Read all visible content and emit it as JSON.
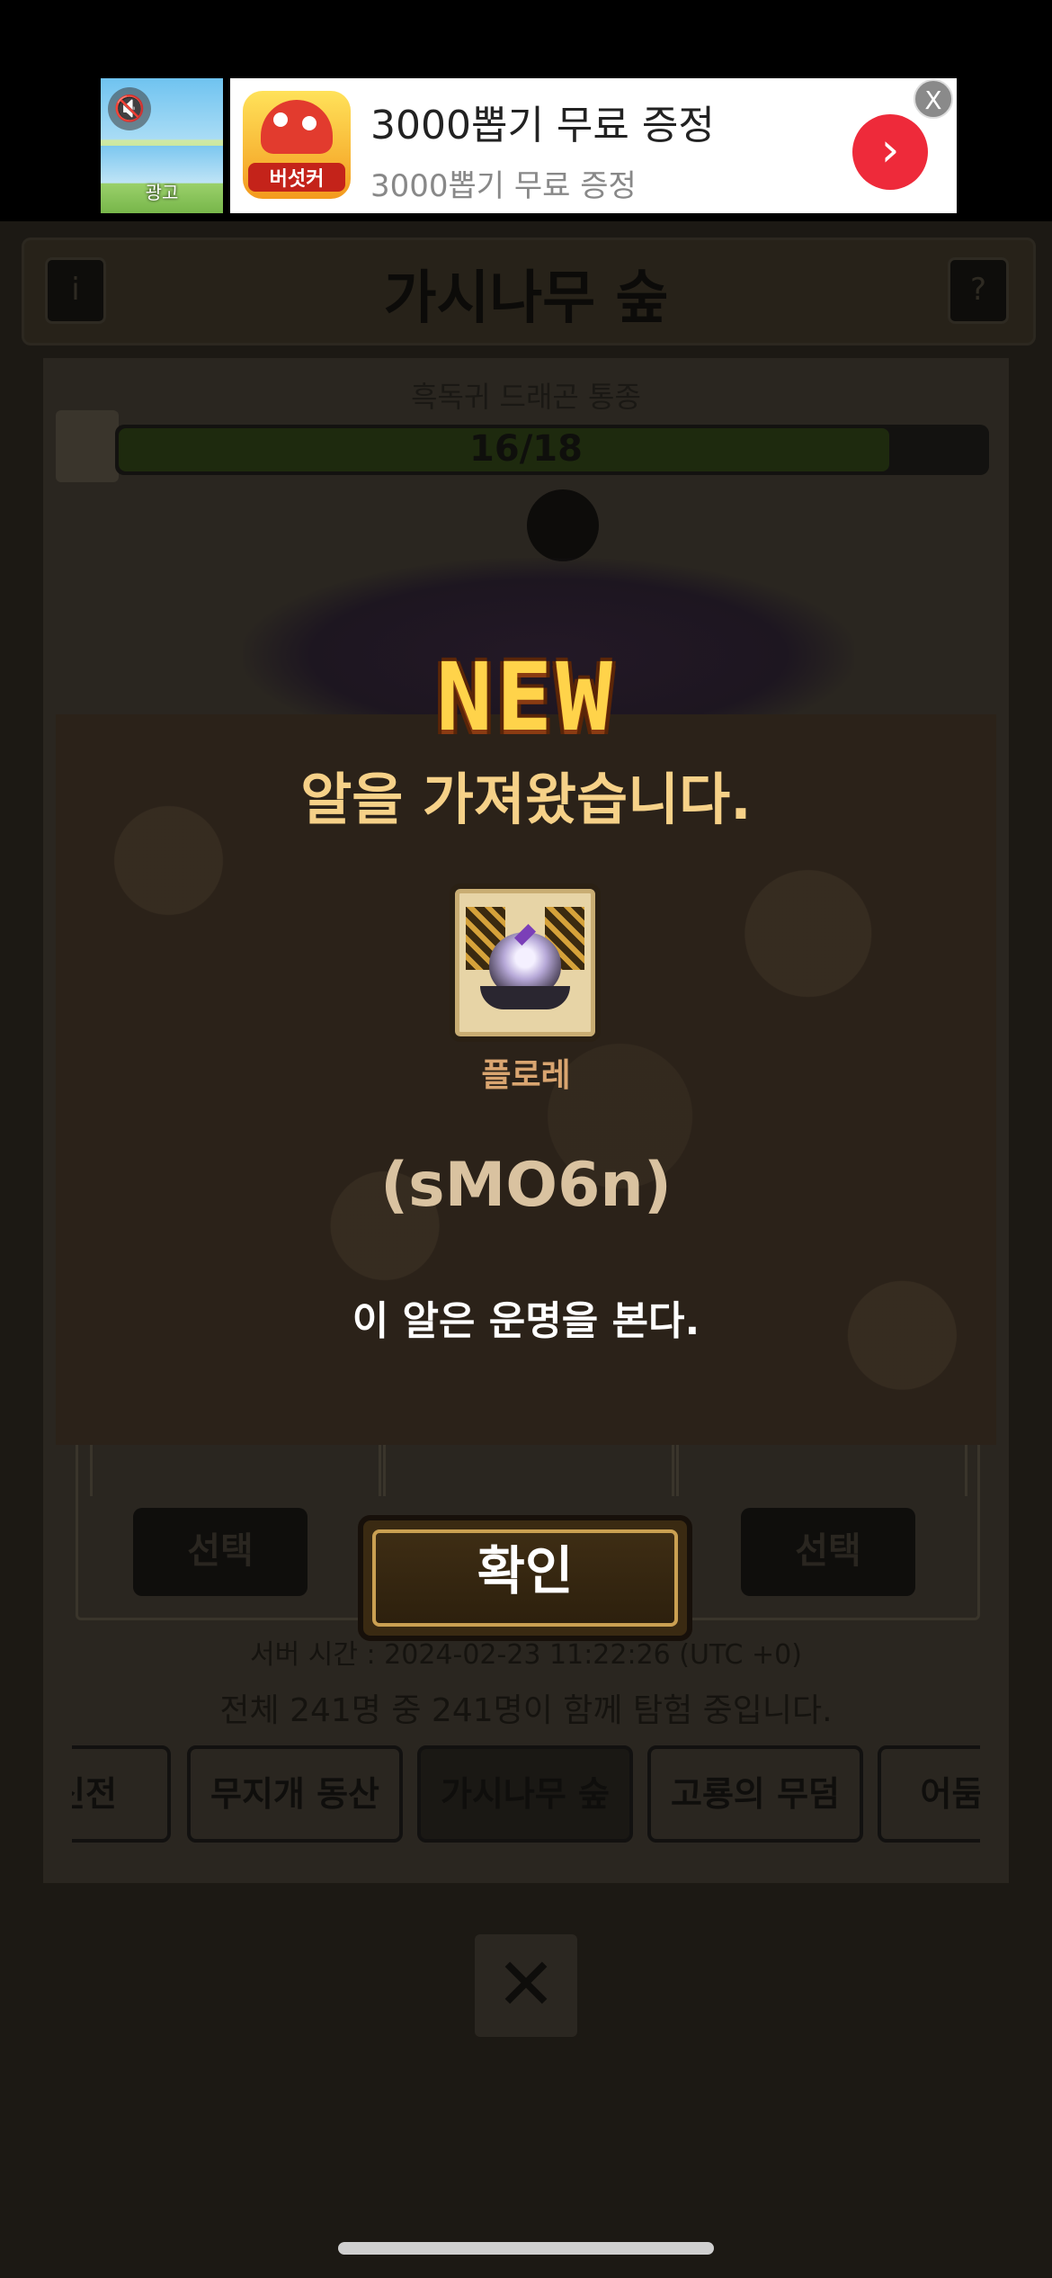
{
  "ad": {
    "label": "광고",
    "mute_icon": "speaker-muted-icon",
    "app_icon_text": "버섯커",
    "title": "3000뽑기 무료 증정",
    "subtitle": "3000뽑기 무료 증정",
    "arrow_icon": "chevron-right-icon",
    "close_label": "X"
  },
  "header": {
    "info_label": "i",
    "title": "가시나무 숲",
    "help_label": "?"
  },
  "boss": {
    "name": "흑독귀 드래곤 통종",
    "hp_text": "16/18",
    "hp_fraction": 0.889
  },
  "slots": {
    "select_label": "선택"
  },
  "status": {
    "server_time": "서버 시간 : 2024-02-23 11:22:26 (UTC +0)",
    "players": "전체 241명 중 241명이 함께 탐험 중입니다."
  },
  "tabs": [
    {
      "label": "신전"
    },
    {
      "label": "무지개 동산"
    },
    {
      "label": "가시나무 숲"
    },
    {
      "label": "고룡의 무덤"
    },
    {
      "label": "어둠의"
    }
  ],
  "close_icon": "close-x-icon",
  "modal": {
    "badge": "NEW",
    "title": "알을 가져왔습니다.",
    "egg_name": "플로레",
    "egg_code": "(sMO6n)",
    "description": "이 알은 운명을 본다.",
    "confirm_label": "확인"
  },
  "colors": {
    "accent_gold": "#f6d188",
    "badge_yellow": "#ffd34a",
    "ad_cta_red": "#ee2a3a"
  }
}
